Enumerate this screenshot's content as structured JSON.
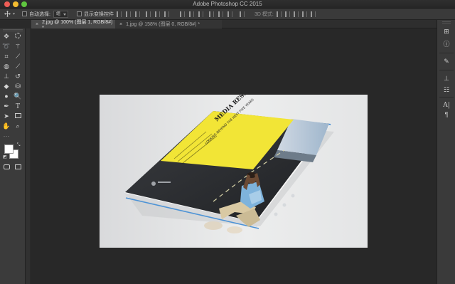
{
  "window": {
    "app_title": "Adobe Photoshop CC 2015"
  },
  "options_bar": {
    "auto_select_label": "自动选择:",
    "auto_select_value": "组",
    "show_transform_label": "显示变换控件",
    "mode_3d_label": "3D 模式:"
  },
  "tabs": [
    {
      "label": "2.jpg @ 100% (图层 1, RGB/8#) *",
      "active": true
    },
    {
      "label": "1.jpg @ 158% (图层 0, RGB/8#) *",
      "active": false
    }
  ],
  "tools": [
    "move-icon",
    "marquee-icon",
    "lasso-icon",
    "magic-wand-icon",
    "crop-icon",
    "eyedropper-icon",
    "healing-icon",
    "brush-icon",
    "stamp-icon",
    "history-brush-icon",
    "eraser-icon",
    "paint-bucket-icon",
    "blur-icon",
    "dodge-icon",
    "pen-icon",
    "type-icon",
    "path-select-icon",
    "rectangle-icon",
    "hand-icon",
    "zoom-icon"
  ],
  "colors": {
    "foreground": "#ffffff",
    "background": "#ffffff",
    "brochure_yellow": "#f2e536",
    "brochure_dark": "#2c2e32"
  },
  "brochure": {
    "title_text": "MEDIA RESIDENTIAL REPORT",
    "subtitle_text": "LOOKING BEYOND THE NEXT FIVE YEARS"
  }
}
